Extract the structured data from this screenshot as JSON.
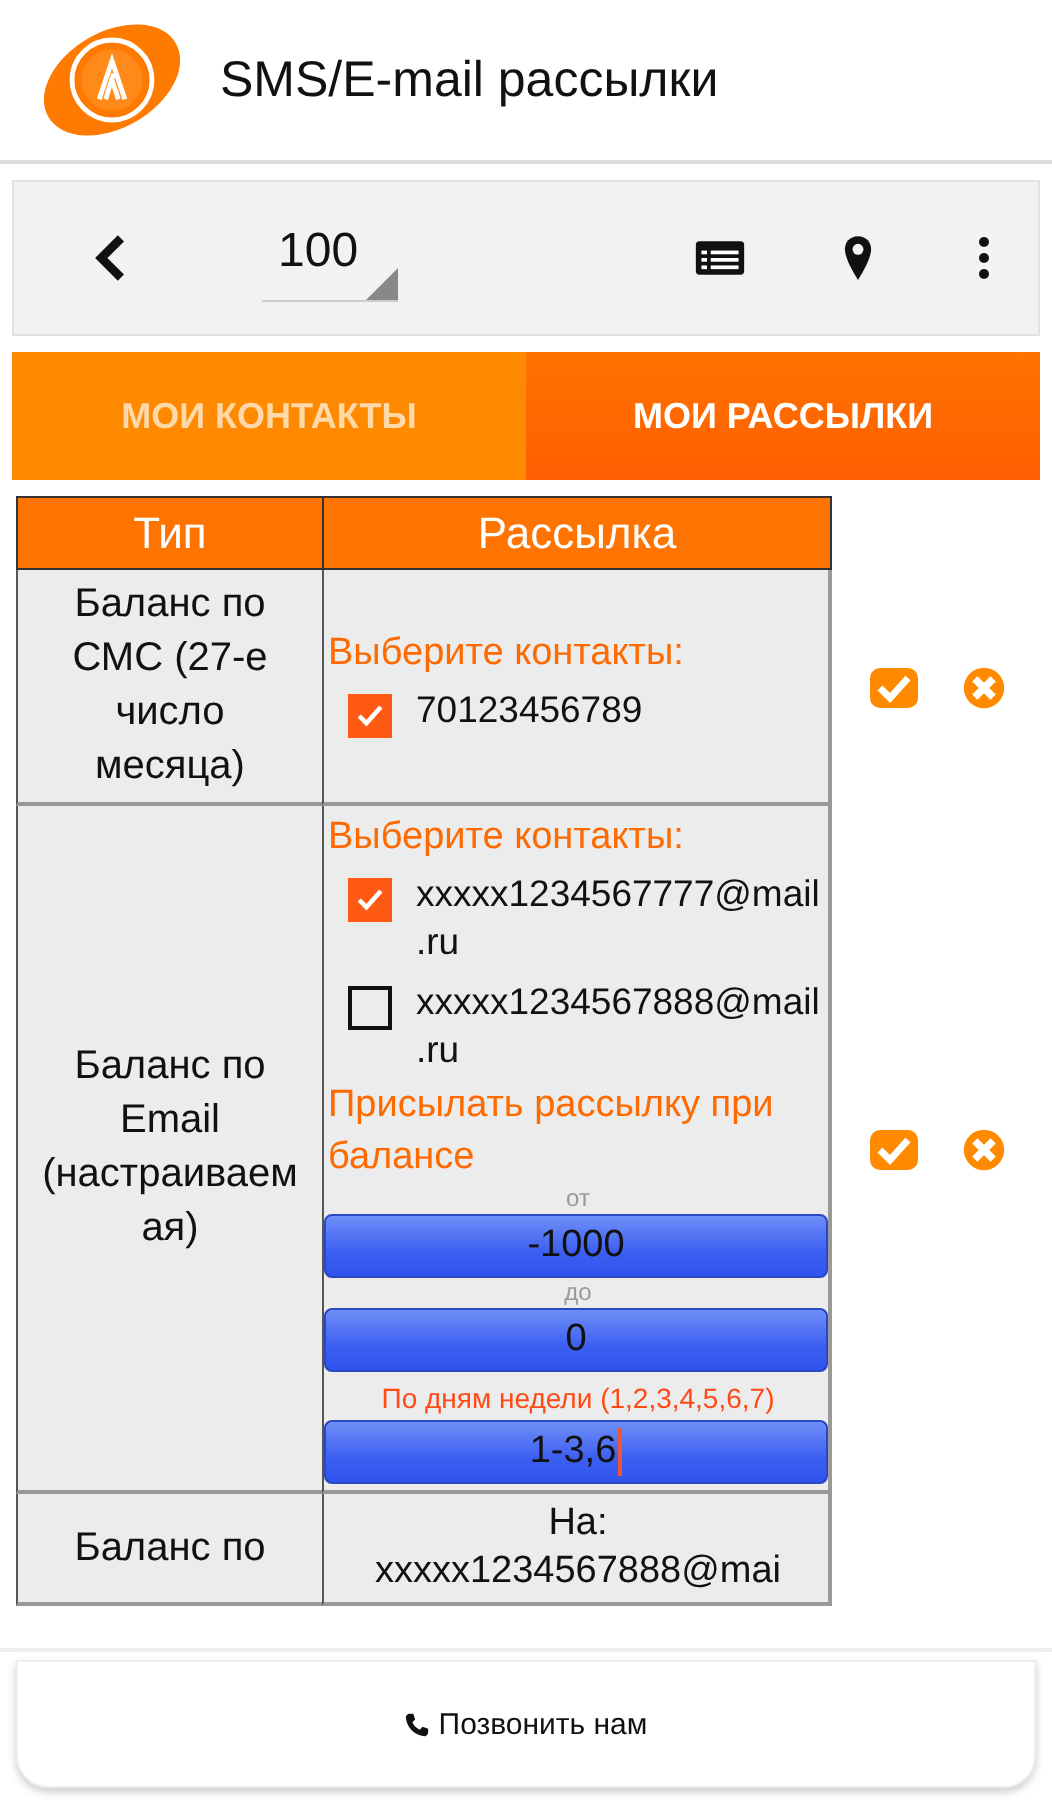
{
  "app_bar": {
    "title": "SMS/E-mail рассылки"
  },
  "toolbar": {
    "page_size": "100"
  },
  "tabs": [
    {
      "label": "МОИ КОНТАКТЫ",
      "selected": false
    },
    {
      "label": "МОИ РАССЫЛКИ",
      "selected": true
    }
  ],
  "table": {
    "columns": [
      "Тип",
      "Рассылка"
    ],
    "rows": [
      {
        "kind": "sms",
        "type": "Баланс по СМС (27-е число месяца)",
        "contacts_label": "Выберите контакты:",
        "contacts": [
          {
            "label": "70123456789",
            "checked": true
          }
        ]
      },
      {
        "kind": "email",
        "type": "Баланс по Email (настраиваемая)",
        "contacts_label": "Выберите контакты:",
        "contacts": [
          {
            "label": "xxxxx1234567777@mail.ru",
            "checked": true
          },
          {
            "label": "xxxxx1234567888@mail.ru",
            "checked": false
          }
        ],
        "threshold_label": "Присылать рассылку при балансе",
        "from_label": "от",
        "from_value": "-1000",
        "to_label": "до",
        "to_value": "0",
        "days_label": "По дням недели (1,2,3,4,5,6,7)",
        "days_value": "1-3,6"
      },
      {
        "kind": "summary",
        "type": "Баланс по",
        "recipient_label": "На:",
        "recipient": "xxxxx1234567888@mai"
      }
    ]
  },
  "call_button": {
    "label": "Позвонить нам"
  }
}
